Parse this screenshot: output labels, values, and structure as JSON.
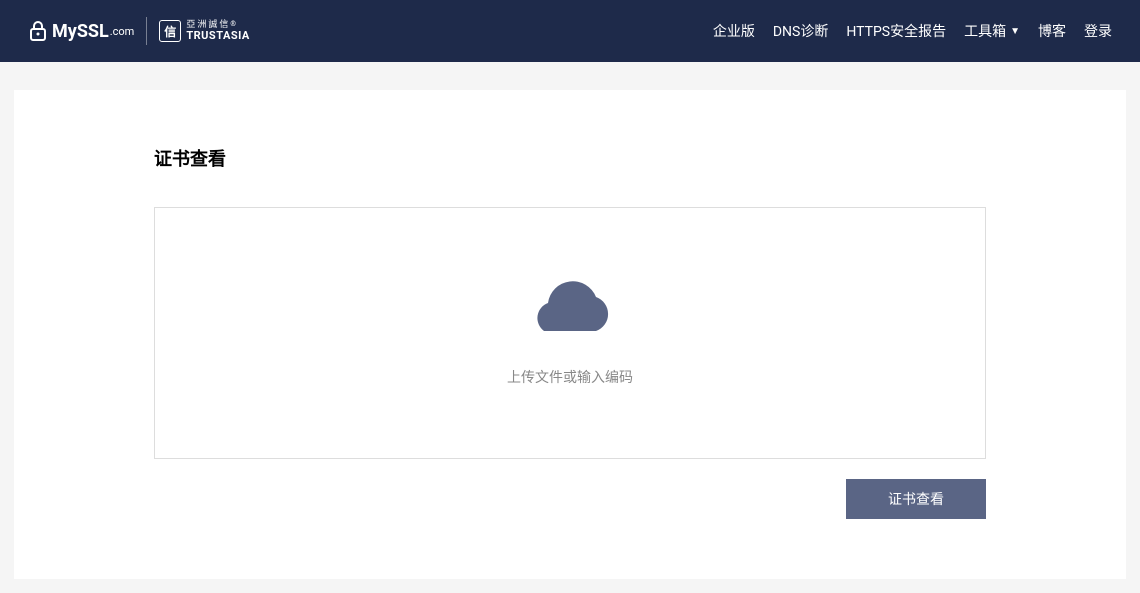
{
  "header": {
    "logo_myssl": "MySSL",
    "logo_myssl_suffix": ".com",
    "logo_trustasia_badge": "信",
    "logo_trustasia_cn": "亞洲誠信",
    "logo_trustasia_en": "TRUSTASIA"
  },
  "nav": {
    "enterprise": "企业版",
    "dns": "DNS诊断",
    "https_report": "HTTPS安全报告",
    "toolbox": "工具箱",
    "blog": "博客",
    "login": "登录"
  },
  "page": {
    "title": "证书查看",
    "upload_text": "上传文件或输入编码",
    "submit_label": "证书查看"
  }
}
